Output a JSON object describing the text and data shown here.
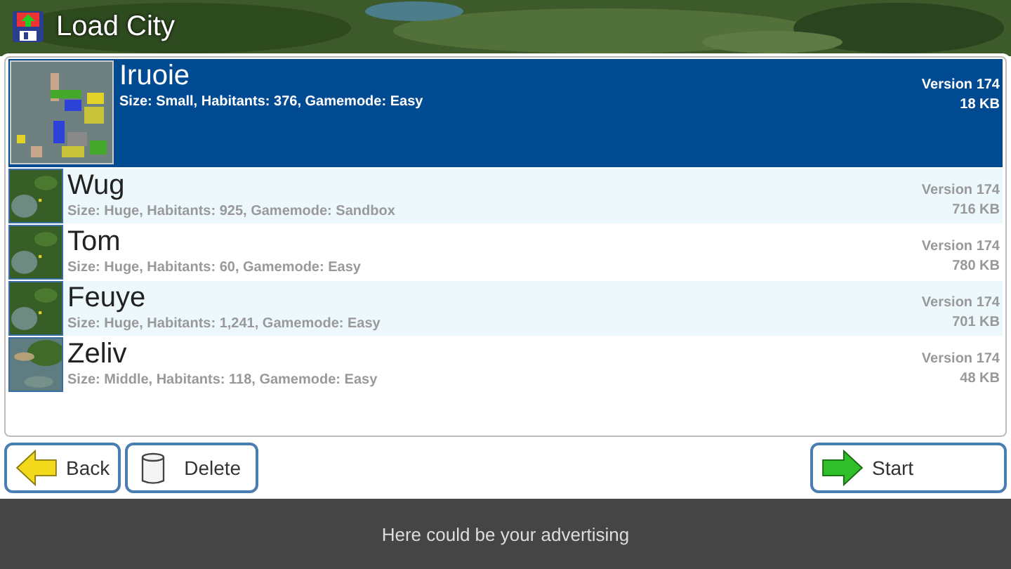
{
  "window": {
    "title": "Load City"
  },
  "cities": [
    {
      "name": "Iruoie",
      "details": "Size: Small, Habitants: 376, Gamemode: Easy",
      "version": "Version 174",
      "size": "18 KB",
      "selected": true
    },
    {
      "name": "Wug",
      "details": "Size: Huge, Habitants: 925, Gamemode: Sandbox",
      "version": "Version 174",
      "size": "716 KB",
      "selected": false
    },
    {
      "name": "Tom",
      "details": "Size: Huge, Habitants: 60, Gamemode: Easy",
      "version": "Version 174",
      "size": "780 KB",
      "selected": false
    },
    {
      "name": "Feuye",
      "details": "Size: Huge, Habitants: 1,241, Gamemode: Easy",
      "version": "Version 174",
      "size": "701 KB",
      "selected": false
    },
    {
      "name": "Zeliv",
      "details": "Size: Middle, Habitants: 118, Gamemode: Easy",
      "version": "Version 174",
      "size": "48 KB",
      "selected": false
    }
  ],
  "buttons": [
    {
      "label": "Back",
      "kind": "back"
    },
    {
      "label": "Delete",
      "kind": "delete"
    },
    {
      "label": "Start",
      "kind": "start"
    }
  ],
  "ad_bar": {
    "text": "Here could be your advertising"
  }
}
